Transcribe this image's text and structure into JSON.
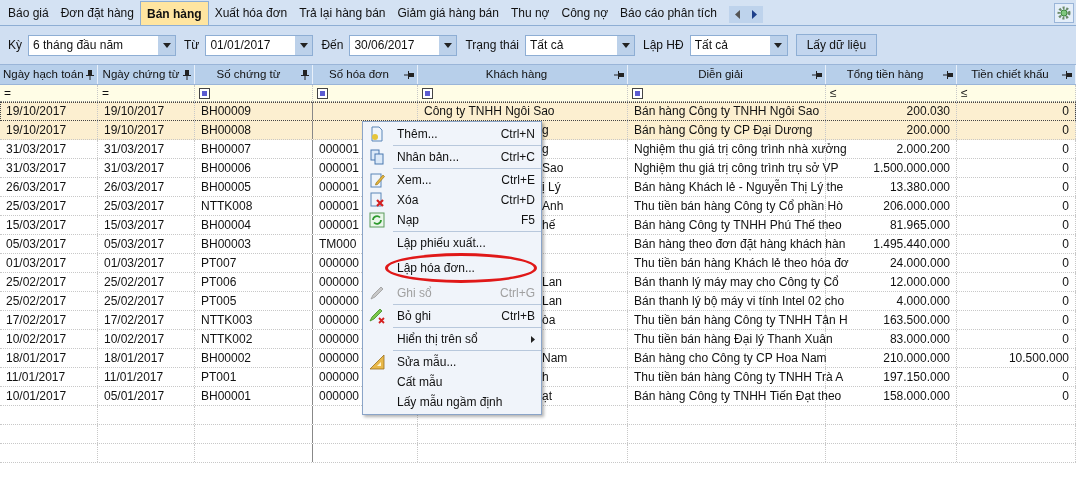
{
  "tabs": [
    {
      "label": "Báo giá",
      "selected": false
    },
    {
      "label": "Đơn đặt hàng",
      "selected": false
    },
    {
      "label": "Bán hàng",
      "selected": true
    },
    {
      "label": "Xuất hóa đơn",
      "selected": false
    },
    {
      "label": "Trả lại hàng bán",
      "selected": false
    },
    {
      "label": "Giảm giá hàng bán",
      "selected": false
    },
    {
      "label": "Thu nợ",
      "selected": false
    },
    {
      "label": "Công nợ",
      "selected": false
    },
    {
      "label": "Báo cáo phân tích",
      "selected": false
    }
  ],
  "filters": [
    {
      "label": "Kỳ",
      "value": "6 tháng đầu năm"
    },
    {
      "label": "Từ",
      "value": "01/01/2017"
    },
    {
      "label": "Đến",
      "value": "30/06/2017"
    },
    {
      "label": "Trạng thái",
      "value": "Tất cả"
    },
    {
      "label": "Lập HĐ",
      "value": "Tất cả"
    }
  ],
  "fetch_button": "Lấy dữ liệu",
  "table": {
    "columns": [
      {
        "label": "Ngày hạch toán",
        "pinned": true,
        "filter": "=",
        "kind": "text"
      },
      {
        "label": "Ngày chứng từ",
        "pinned": true,
        "filter": "=",
        "kind": "text"
      },
      {
        "label": "Số chứng từ",
        "pinned": true,
        "kind": "text"
      },
      {
        "label": "Số hóa đơn",
        "pinned": false,
        "kind": "text"
      },
      {
        "label": "Khách hàng",
        "pinned": false,
        "kind": "text"
      },
      {
        "label": "Diễn giải",
        "pinned": false,
        "kind": "text"
      },
      {
        "label": "Tổng tiền hàng",
        "pinned": false,
        "filter": "≤",
        "kind": "number"
      },
      {
        "label": "Tiền chiết khấu",
        "pinned": false,
        "filter": "≤",
        "kind": "number"
      }
    ],
    "rows": [
      {
        "selected": true,
        "cells": [
          "19/10/2017",
          "19/10/2017",
          "BH00009",
          "",
          "Công ty TNHH Ngôi Sao",
          "Bán hàng Công ty TNHH Ngôi Sao",
          "200.030",
          "0"
        ]
      },
      {
        "selected": true,
        "cells": [
          "19/10/2017",
          "19/10/2017",
          "BH00008",
          "",
          "g",
          "Bán hàng Công ty CP Đại Dương",
          "200.000",
          "0"
        ]
      },
      {
        "selected": false,
        "cells": [
          "31/03/2017",
          "31/03/2017",
          "BH00007",
          "000001",
          "g",
          "Nghiệm thu giá trị công trình nhà xưởng",
          "2.000.200",
          "0"
        ]
      },
      {
        "selected": false,
        "cells": [
          "31/03/2017",
          "31/03/2017",
          "BH00006",
          "000001",
          "Sao",
          "Nghiệm thu giá trị công trình trụ sở VP",
          "1.500.000.000",
          "0"
        ]
      },
      {
        "selected": false,
        "cells": [
          "26/03/2017",
          "26/03/2017",
          "BH00005",
          "000001",
          "ị Lý",
          "Bán hàng Khách lẻ - Nguyễn Thị Lý the",
          "13.380.000",
          "0"
        ]
      },
      {
        "selected": false,
        "cells": [
          "25/03/2017",
          "25/03/2017",
          "NTTK008",
          "000001",
          "Anh",
          "Thu tiền bán hàng Công ty Cổ phần Hò",
          "206.000.000",
          "0"
        ]
      },
      {
        "selected": false,
        "cells": [
          "15/03/2017",
          "15/03/2017",
          "BH00004",
          "000001",
          "hế",
          "Bán hàng Công ty TNHH Phú Thế theo",
          "81.965.000",
          "0"
        ]
      },
      {
        "selected": false,
        "cells": [
          "05/03/2017",
          "05/03/2017",
          "BH00003",
          "TM000",
          "",
          "Bán hàng theo đơn đặt hàng khách hàn",
          "1.495.440.000",
          "0"
        ]
      },
      {
        "selected": false,
        "cells": [
          "01/03/2017",
          "01/03/2017",
          "PT007",
          "000000",
          "",
          "Thu tiền bán hàng Khách lẻ theo hóa đơ",
          "24.000.000",
          "0"
        ]
      },
      {
        "selected": false,
        "cells": [
          "25/02/2017",
          "25/02/2017",
          "PT006",
          "000000",
          "Lan",
          "Bán thanh lý máy may cho Công ty Cổ",
          "12.000.000",
          "0"
        ]
      },
      {
        "selected": false,
        "cells": [
          "25/02/2017",
          "25/02/2017",
          "PT005",
          "000000",
          "Lan",
          "Bán thanh lý bộ máy vi tính Intel 02 cho",
          "4.000.000",
          "0"
        ]
      },
      {
        "selected": false,
        "cells": [
          "17/02/2017",
          "17/02/2017",
          "NTTK003",
          "000000",
          "òa",
          "Thu tiền bán hàng Công ty TNHH Tân H",
          "163.500.000",
          "0"
        ]
      },
      {
        "selected": false,
        "cells": [
          "10/02/2017",
          "10/02/2017",
          "NTTK002",
          "000000",
          "",
          "Thu tiền bán hàng Đại lý Thanh Xuân",
          "83.000.000",
          "0"
        ]
      },
      {
        "selected": false,
        "cells": [
          "18/01/2017",
          "18/01/2017",
          "BH00002",
          "000000",
          "Nam",
          "Bán hàng cho Công ty CP Hoa Nam",
          "210.000.000",
          "10.500.000"
        ]
      },
      {
        "selected": false,
        "cells": [
          "11/01/2017",
          "11/01/2017",
          "PT001",
          "000000",
          "h",
          "Thu tiền bán hàng Công ty TNHH Trà A",
          "197.150.000",
          "0"
        ]
      },
      {
        "selected": false,
        "cells": [
          "10/01/2017",
          "05/01/2017",
          "BH00001",
          "000000",
          "ạt",
          "Bán hàng Công ty TNHH Tiến Đạt theo",
          "158.000.000",
          "0"
        ]
      }
    ]
  },
  "context_menu": [
    {
      "kind": "item",
      "label": "Thêm...",
      "shortcut": "Ctrl+N",
      "disabled": false
    },
    {
      "kind": "separator"
    },
    {
      "kind": "item",
      "label": "Nhân bản...",
      "shortcut": "Ctrl+C",
      "disabled": false
    },
    {
      "kind": "separator"
    },
    {
      "kind": "item",
      "label": "Xem...",
      "shortcut": "Ctrl+E",
      "disabled": false
    },
    {
      "kind": "item",
      "label": "Xóa",
      "shortcut": "Ctrl+D",
      "disabled": false
    },
    {
      "kind": "item",
      "label": "Nạp",
      "shortcut": "F5",
      "disabled": false
    },
    {
      "kind": "separator"
    },
    {
      "kind": "item",
      "label": "Lập phiếu xuất...",
      "disabled": false
    },
    {
      "kind": "item",
      "label": "Lập hóa đơn...",
      "disabled": false,
      "highlighted": true
    },
    {
      "kind": "item",
      "label": "Ghi sổ",
      "shortcut": "Ctrl+G",
      "disabled": true
    },
    {
      "kind": "separator"
    },
    {
      "kind": "item",
      "label": "Bỏ ghi",
      "shortcut": "Ctrl+B",
      "disabled": false
    },
    {
      "kind": "separator"
    },
    {
      "kind": "item",
      "label": "Hiển thị trên sổ",
      "disabled": false,
      "submenu": true
    },
    {
      "kind": "separator"
    },
    {
      "kind": "item",
      "label": "Sửa mẫu...",
      "disabled": false
    },
    {
      "kind": "item",
      "label": "Cất mẫu",
      "disabled": false
    },
    {
      "kind": "item",
      "label": "Lấy mẫu ngầm định",
      "disabled": false
    }
  ]
}
